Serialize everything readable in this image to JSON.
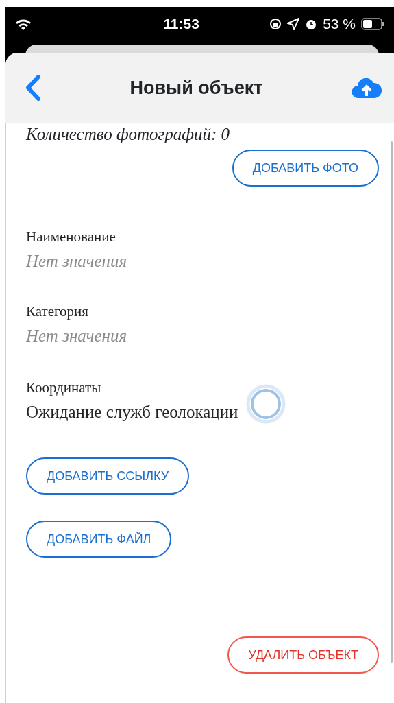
{
  "status_bar": {
    "time": "11:53",
    "battery": "53 %"
  },
  "header": {
    "title": "Новый объект"
  },
  "photos": {
    "count_text": "Количество фотографий: 0",
    "add_button": "ДОБАВИТЬ ФОТО"
  },
  "fields": [
    {
      "label": "Наименование",
      "placeholder": "Нет значения",
      "kind": "input"
    },
    {
      "label": "Категория",
      "placeholder": "Нет значения",
      "kind": "input"
    },
    {
      "label": "Координаты",
      "value": "Ожидание служб геолокации",
      "kind": "loading"
    }
  ],
  "buttons": [
    {
      "label": "ДОБАВИТЬ ССЫЛКУ"
    },
    {
      "label": "ДОБАВИТЬ ФАЙЛ"
    }
  ],
  "delete_button": {
    "label": "УДАЛИТЬ ОБЪЕКТ",
    "kind": "danger"
  }
}
